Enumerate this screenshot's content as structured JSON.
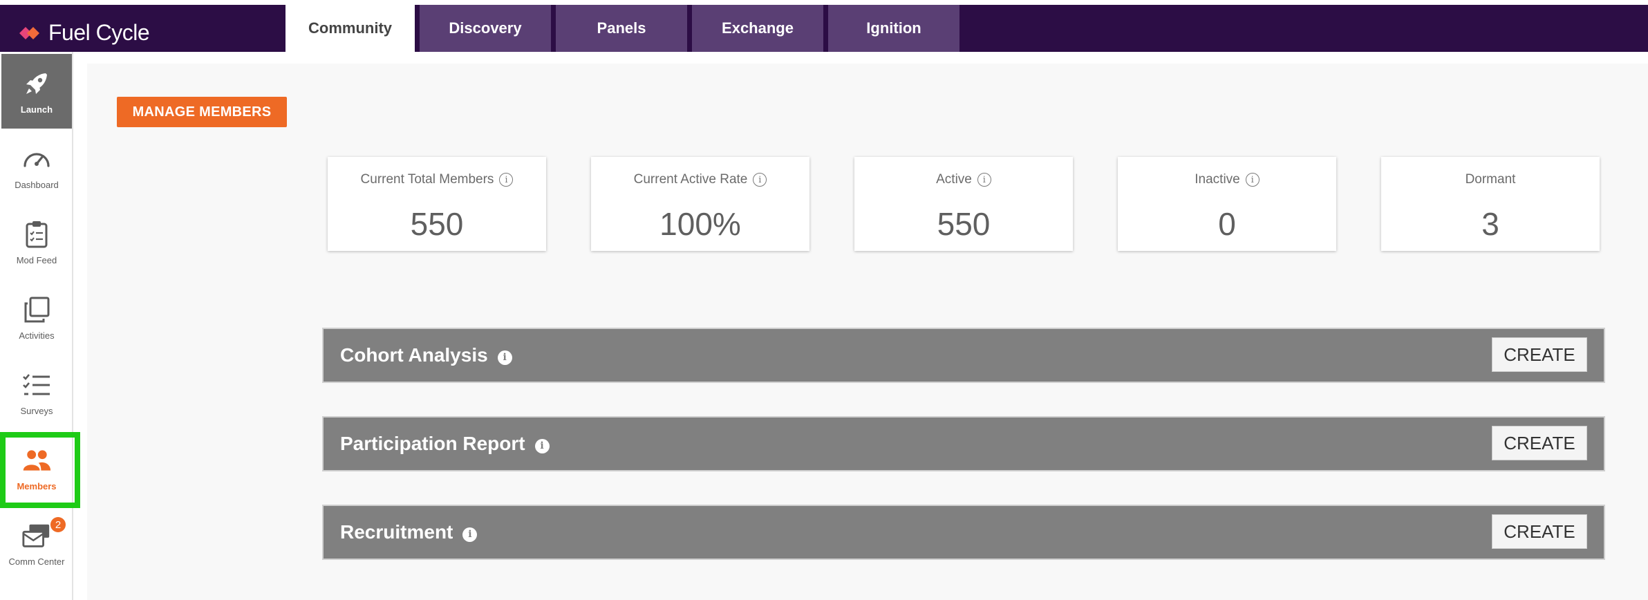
{
  "brand": {
    "name": "Fuel Cycle"
  },
  "tabs": [
    {
      "label": "Community",
      "active": true
    },
    {
      "label": "Discovery"
    },
    {
      "label": "Panels"
    },
    {
      "label": "Exchange"
    },
    {
      "label": "Ignition"
    }
  ],
  "sidebar": {
    "items": [
      {
        "label": "Launch",
        "icon": "rocket-icon"
      },
      {
        "label": "Dashboard",
        "icon": "gauge-icon"
      },
      {
        "label": "Mod Feed",
        "icon": "clipboard-icon"
      },
      {
        "label": "Activities",
        "icon": "copy-icon"
      },
      {
        "label": "Surveys",
        "icon": "checklist-icon"
      },
      {
        "label": "Members",
        "icon": "users-icon",
        "selected": true
      },
      {
        "label": "Comm Center",
        "icon": "messages-icon",
        "badge": "2"
      }
    ]
  },
  "main": {
    "manage_label": "MANAGE MEMBERS",
    "stats": [
      {
        "label": "Current Total Members",
        "value": "550"
      },
      {
        "label": "Current Active Rate",
        "value": "100%"
      },
      {
        "label": "Active",
        "value": "550"
      },
      {
        "label": "Inactive",
        "value": "0"
      },
      {
        "label": "Dormant",
        "value": "3"
      }
    ],
    "panels": [
      {
        "title": "Cohort Analysis",
        "button": "CREATE"
      },
      {
        "title": "Participation Report",
        "button": "CREATE"
      },
      {
        "title": "Recruitment",
        "button": "CREATE"
      }
    ],
    "info_glyph": "i"
  },
  "colors": {
    "topbar": "#2c0d45",
    "accent": "#ee6a25",
    "highlight": "#1ecb16",
    "panel": "#808080"
  }
}
